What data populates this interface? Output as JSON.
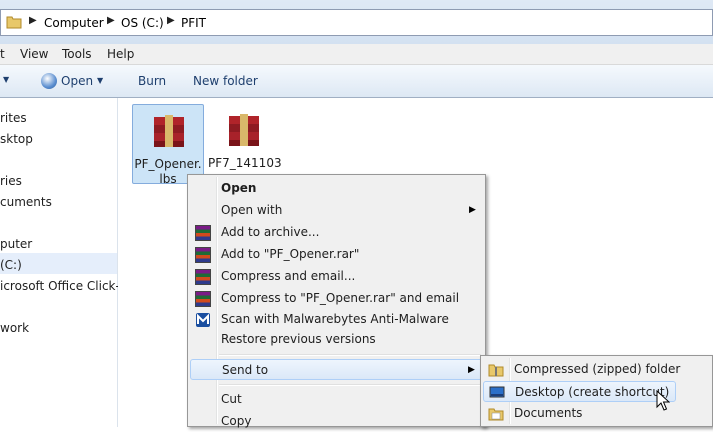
{
  "address": {
    "crumbs": [
      "Computer",
      "OS (C:)",
      "PFIT"
    ]
  },
  "menubar": {
    "items": [
      "t",
      "View",
      "Tools",
      "Help"
    ]
  },
  "toolbar": {
    "open": "Open",
    "burn": "Burn",
    "new_folder": "New folder"
  },
  "nav": {
    "items": [
      "rites",
      "sktop",
      "ries",
      "cuments",
      "puter",
      "(C:)",
      "icrosoft Office Click-to",
      "work"
    ]
  },
  "files": [
    {
      "name": "PF_Opener.\nlbs",
      "line1": "PF_Opener.",
      "line2": "lbs",
      "selected": true
    },
    {
      "name": "PF7_141103",
      "line1": "PF7_141103",
      "line2": "..."
    }
  ],
  "context_menu": {
    "items": [
      {
        "label": "Open",
        "bold": true
      },
      {
        "label": "Open with",
        "submenu": true
      },
      {
        "label": "Add to archive...",
        "icon": "winrar-icon"
      },
      {
        "label": "Add to \"PF_Opener.rar\"",
        "icon": "winrar-icon"
      },
      {
        "label": "Compress and email...",
        "icon": "winrar-icon"
      },
      {
        "label": "Compress to \"PF_Opener.rar\" and email",
        "icon": "winrar-icon"
      },
      {
        "label": "Scan with Malwarebytes Anti-Malware",
        "icon": "malwarebytes-icon"
      },
      {
        "label": "Restore previous versions"
      },
      {
        "label": "Send to",
        "submenu": true,
        "highlighted": true
      },
      {
        "label": "Cut"
      },
      {
        "label": "Copy"
      }
    ]
  },
  "sendto_menu": {
    "items": [
      {
        "label": "Compressed (zipped) folder",
        "icon": "zip-folder-icon"
      },
      {
        "label": "Desktop (create shortcut)",
        "icon": "desktop-icon",
        "highlighted": true
      },
      {
        "label": "Documents",
        "icon": "documents-icon"
      }
    ]
  },
  "colors": {
    "accent": "#1e3f6e",
    "highlight_border": "#aecff7",
    "selected_file": "#cce4f7"
  }
}
